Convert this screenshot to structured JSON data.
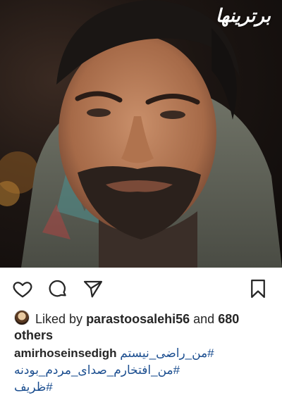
{
  "post": {
    "watermark": "برترینها",
    "likes": {
      "prefix": "Liked by",
      "user": "parastoosalehi56",
      "middle": "and",
      "count": "680",
      "suffix": "others"
    },
    "caption": {
      "username": "amirhoseinsedigh",
      "hashtags": [
        "#من_راضی_نیستم",
        "#من_افتخارم_صدای_مردم_بودنه",
        "#ظریف"
      ]
    }
  },
  "icons": {
    "like": "heart-icon",
    "comment": "comment-bubble-icon",
    "share": "paper-plane-icon",
    "save": "bookmark-icon"
  },
  "colors": {
    "text": "#262626",
    "hashtag": "#1a4d8f",
    "background": "#ffffff"
  }
}
